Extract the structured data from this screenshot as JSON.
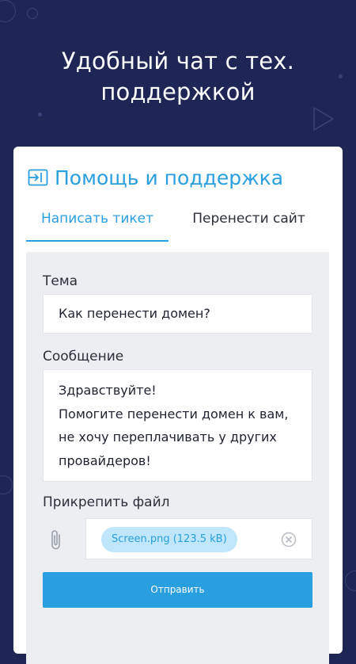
{
  "promo": {
    "headline_line1": "Удобный чат с тех.",
    "headline_line2": "поддержкой"
  },
  "card": {
    "title": "Помощь и поддержка",
    "title_icon": "login-arrow-icon",
    "tabs": [
      {
        "label": "Написать тикет",
        "active": true
      },
      {
        "label": "Перенести сайт",
        "active": false
      }
    ]
  },
  "form": {
    "subject_label": "Тема",
    "subject_value": "Как перенести домен?",
    "message_label": "Сообщение",
    "message_lines": [
      "Здравствуйте!",
      "Помогите перенести домен к вам,",
      "не хочу переплачивать у других",
      "провайдеров!"
    ],
    "attach_label": "Прикрепить файл",
    "attachment": "Screen.png (123.5 kB)",
    "submit_label": "Отправить"
  },
  "colors": {
    "background": "#1f2555",
    "accent": "#2a9fe0",
    "chip_bg": "#bfe6fb",
    "form_bg": "#eceef2"
  }
}
